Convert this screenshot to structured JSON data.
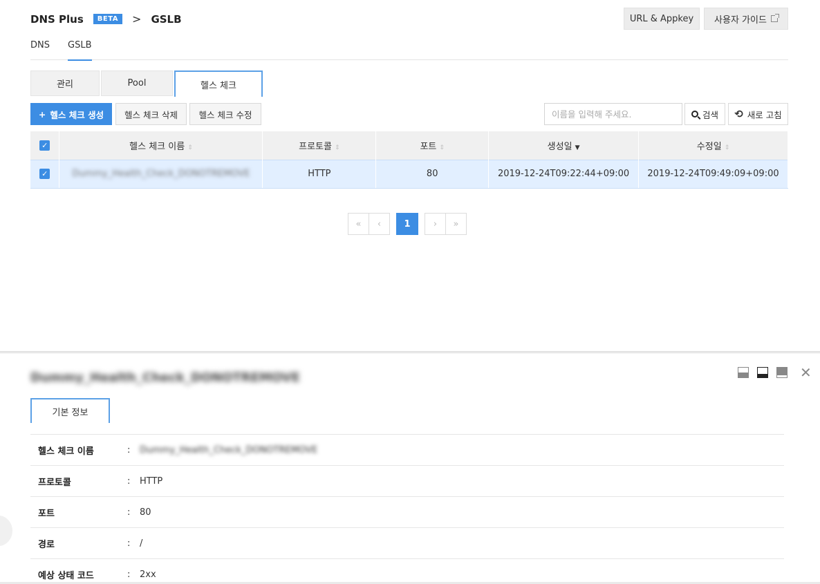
{
  "header": {
    "product": "DNS Plus",
    "beta_badge": "BETA",
    "separator": ">",
    "current": "GSLB",
    "url_appkey_button": "URL & Appkey",
    "guide_button": "사용자 가이드"
  },
  "subnav": [
    {
      "label": "DNS",
      "active": false
    },
    {
      "label": "GSLB",
      "active": true
    }
  ],
  "tabs": [
    {
      "label": "관리",
      "active": false
    },
    {
      "label": "Pool",
      "active": false
    },
    {
      "label": "헬스 체크",
      "active": true
    }
  ],
  "toolbar": {
    "create_label": "헬스 체크 생성",
    "create_icon": "+",
    "delete_label": "헬스 체크 삭제",
    "edit_label": "헬스 체크 수정",
    "search_placeholder": "이름을 입력해 주세요.",
    "search_label": "검색",
    "refresh_label": "새로 고침",
    "refresh_icon": "⟲"
  },
  "table": {
    "columns": [
      "헬스 체크 이름",
      "프로토콜",
      "포트",
      "생성일",
      "수정일"
    ],
    "sorted_column": "생성일",
    "rows": [
      {
        "selected": true,
        "name": "Dummy_Health_Check_DONOTREMOVE",
        "protocol": "HTTP",
        "port": "80",
        "created": "2019-12-24T09:22:44+09:00",
        "modified": "2019-12-24T09:49:09+09:00"
      }
    ]
  },
  "pagination": {
    "first": "«",
    "prev": "‹",
    "current": "1",
    "next": "›",
    "last": "»"
  },
  "detail": {
    "title": "Dummy_Health_Check_DONOTREMOVE",
    "close_icon": "✕",
    "tab_label": "기본 정보",
    "separator": ":",
    "fields": [
      {
        "label": "헬스 체크 이름",
        "value": "Dummy_Health_Check_DONOTREMOVE"
      },
      {
        "label": "프로토콜",
        "value": "HTTP"
      },
      {
        "label": "포트",
        "value": "80"
      },
      {
        "label": "경로",
        "value": "/"
      },
      {
        "label": "예상 상태 코드",
        "value": "2xx"
      }
    ]
  },
  "colors": {
    "accent": "#3c8de3",
    "selected_row": "#e2efff",
    "header_bg": "#f0f0f0"
  }
}
